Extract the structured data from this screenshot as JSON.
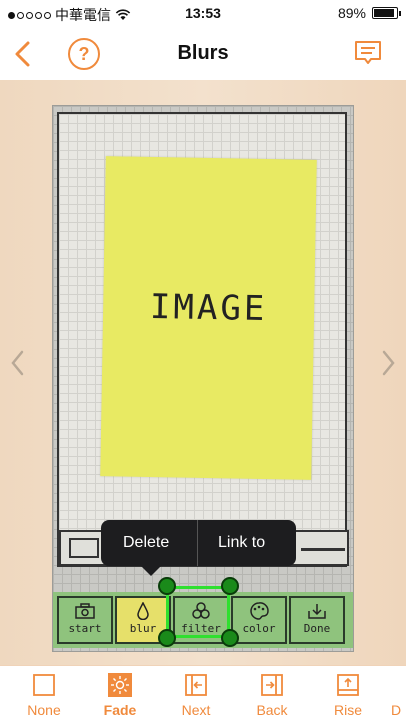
{
  "status": {
    "carrier": "中華電信",
    "time": "13:53",
    "battery": "89%",
    "battery_level": 0.89
  },
  "nav": {
    "title": "Blurs",
    "help_symbol": "?"
  },
  "image": {
    "sticky_text": "IMAGE",
    "tools": [
      {
        "label": "start"
      },
      {
        "label": "blur"
      },
      {
        "label": "filter"
      },
      {
        "label": "color"
      },
      {
        "label": "Done"
      }
    ]
  },
  "popup": {
    "delete_label": "Delete",
    "link_label": "Link to"
  },
  "tabs": [
    {
      "label": "None"
    },
    {
      "label": "Fade"
    },
    {
      "label": "Next"
    },
    {
      "label": "Back"
    },
    {
      "label": "Rise"
    },
    {
      "label": "D"
    }
  ],
  "colors": {
    "accent": "#f08a3c",
    "hotspot": "#2fe02f",
    "toolstrip": "#8fc37d",
    "sticky": "#e8ea63"
  }
}
